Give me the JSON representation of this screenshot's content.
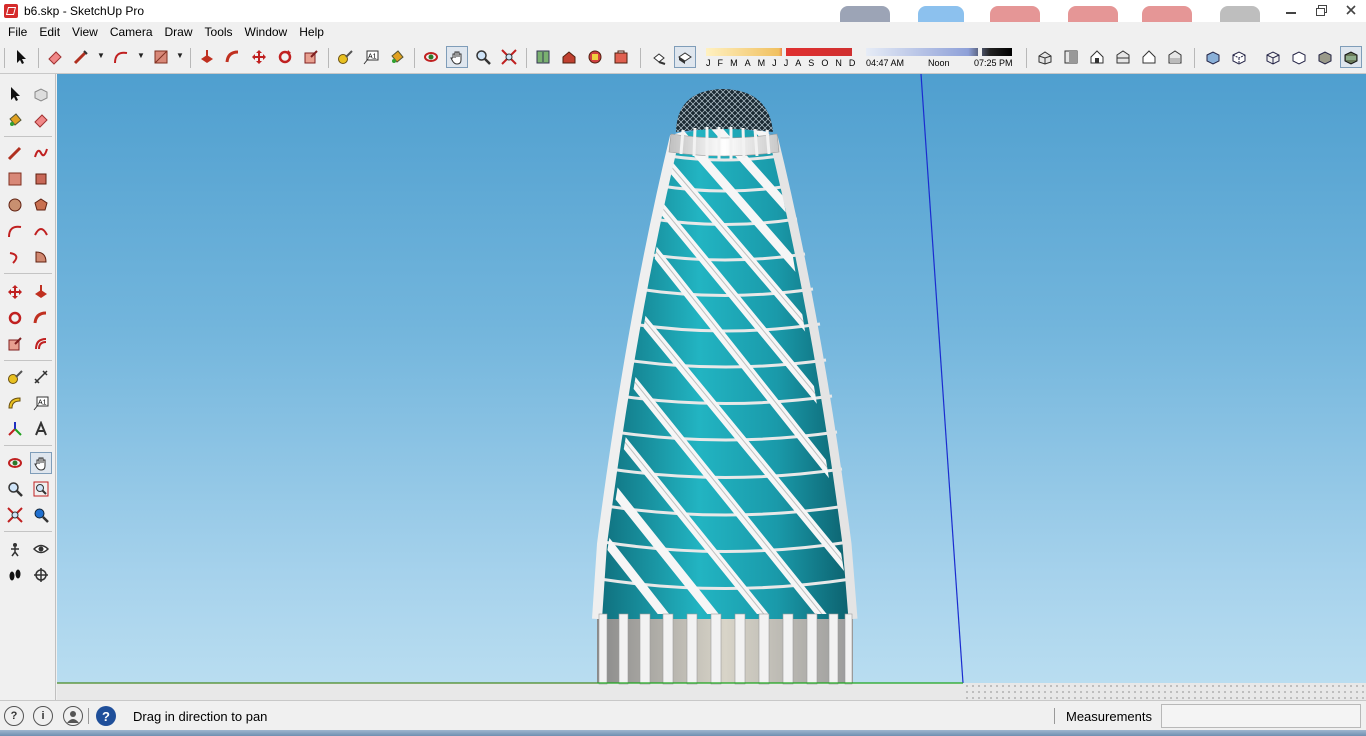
{
  "window": {
    "title": "b6.skp - SketchUp Pro",
    "controls": [
      "minimize",
      "restore",
      "close"
    ]
  },
  "menu": [
    "File",
    "Edit",
    "View",
    "Camera",
    "Draw",
    "Tools",
    "Window",
    "Help"
  ],
  "toolbar": {
    "shadow_months": [
      "J",
      "F",
      "M",
      "A",
      "M",
      "J",
      "J",
      "A",
      "S",
      "O",
      "N",
      "D"
    ],
    "time_start": "04:47 AM",
    "time_mid": "Noon",
    "time_end": "07:25 PM",
    "active_tool": "pan"
  },
  "left_toolbar": {
    "active_tool": "pan"
  },
  "status": {
    "message": "Drag in direction to pan",
    "measurements_label": "Measurements",
    "measurements_value": ""
  },
  "colors": {
    "sky_top": "#4f9fcf",
    "sky_bottom": "#bcdff1",
    "glass": "#1fa6b4",
    "frame": "#f4f4f4",
    "blue_axis": "#1a2bd0",
    "green_axis": "#1fa51f"
  }
}
